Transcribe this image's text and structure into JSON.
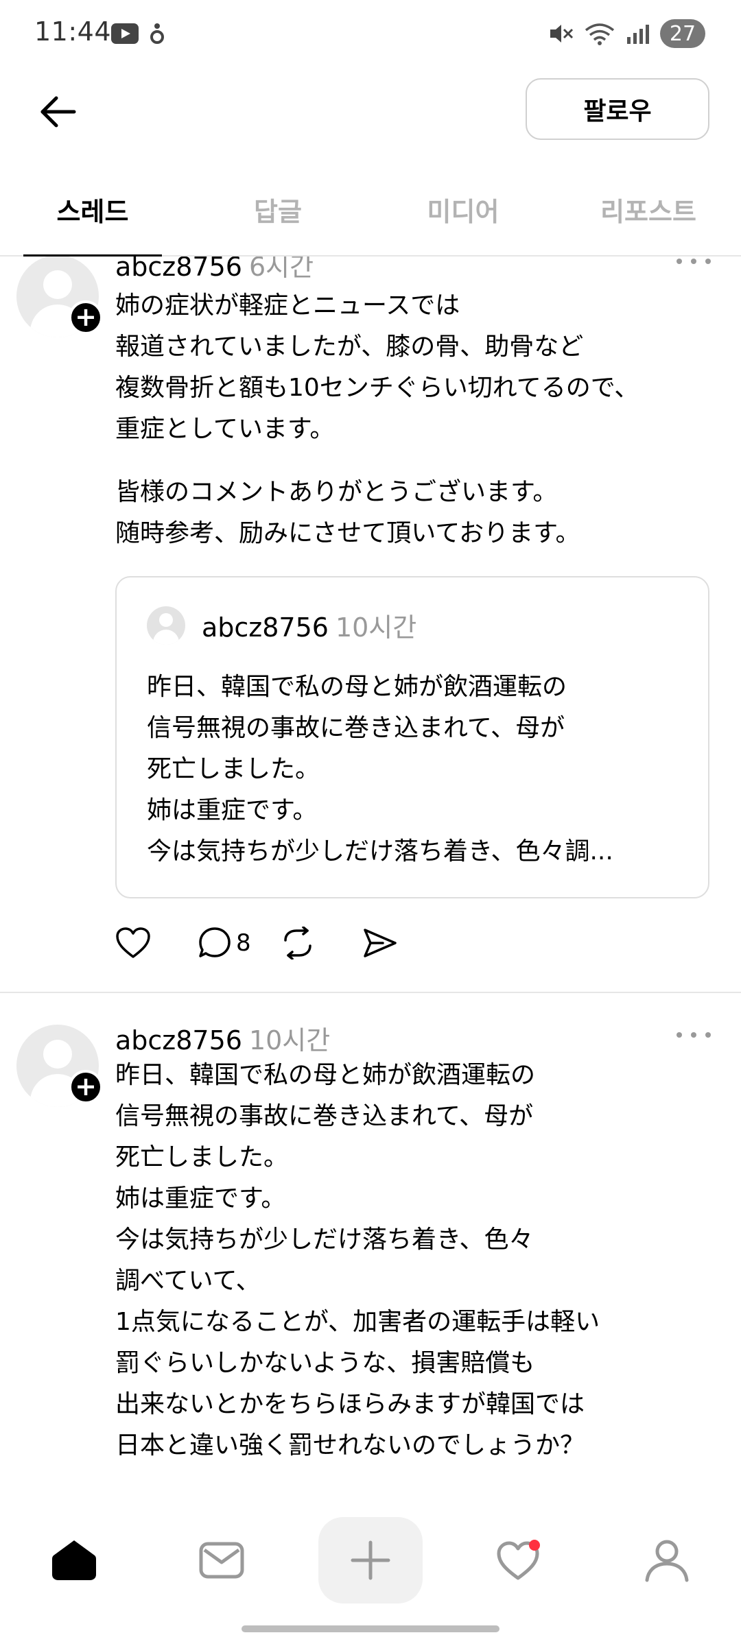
{
  "status_bar": {
    "time": "11:44",
    "battery": "27"
  },
  "header": {
    "follow_label": "팔로우"
  },
  "tabs": [
    {
      "label": "스레드",
      "active": true
    },
    {
      "label": "답글",
      "active": false
    },
    {
      "label": "미디어",
      "active": false
    },
    {
      "label": "리포스트",
      "active": false
    }
  ],
  "posts": [
    {
      "username": "abcz8756",
      "time": "6시간",
      "lines": [
        "姉の症状が軽症とニュースでは",
        "報道されていましたが、膝の骨、助骨など",
        "複数骨折と額も10センチぐらい切れてるので、",
        "重症としています。",
        "",
        "皆様のコメントありがとうございます。",
        "随時参考、励みにさせて頂いております。"
      ],
      "quote": {
        "username": "abcz8756",
        "time": "10시간",
        "lines": [
          "昨日、韓国で私の母と姉が飲酒運転の",
          "信号無視の事故に巻き込まれて、母が",
          "死亡しました。",
          "姉は重症です。",
          "今は気持ちが少しだけ落ち着き、色々調..."
        ]
      },
      "reply_count": "8"
    },
    {
      "username": "abcz8756",
      "time": "10시간",
      "lines": [
        "昨日、韓国で私の母と姉が飲酒運転の",
        "信号無視の事故に巻き込まれて、母が",
        "死亡しました。",
        "姉は重症です。",
        "今は気持ちが少しだけ落ち着き、色々",
        "調べていて、",
        "1点気になることが、加害者の運転手は軽い",
        "罰ぐらいしかないような、損害賠償も",
        "出来ないとかをちらほらみますが韓国では",
        "日本と違い強く罰せれないのでしょうか？"
      ]
    }
  ],
  "bottom_nav": [
    {
      "icon": "home-icon"
    },
    {
      "icon": "search-icon"
    },
    {
      "icon": "plus-icon"
    },
    {
      "icon": "activity-heart-icon"
    },
    {
      "icon": "profile-icon"
    }
  ],
  "colors": {
    "notification_dot": "#ff3040",
    "muted_text": "#999999"
  }
}
